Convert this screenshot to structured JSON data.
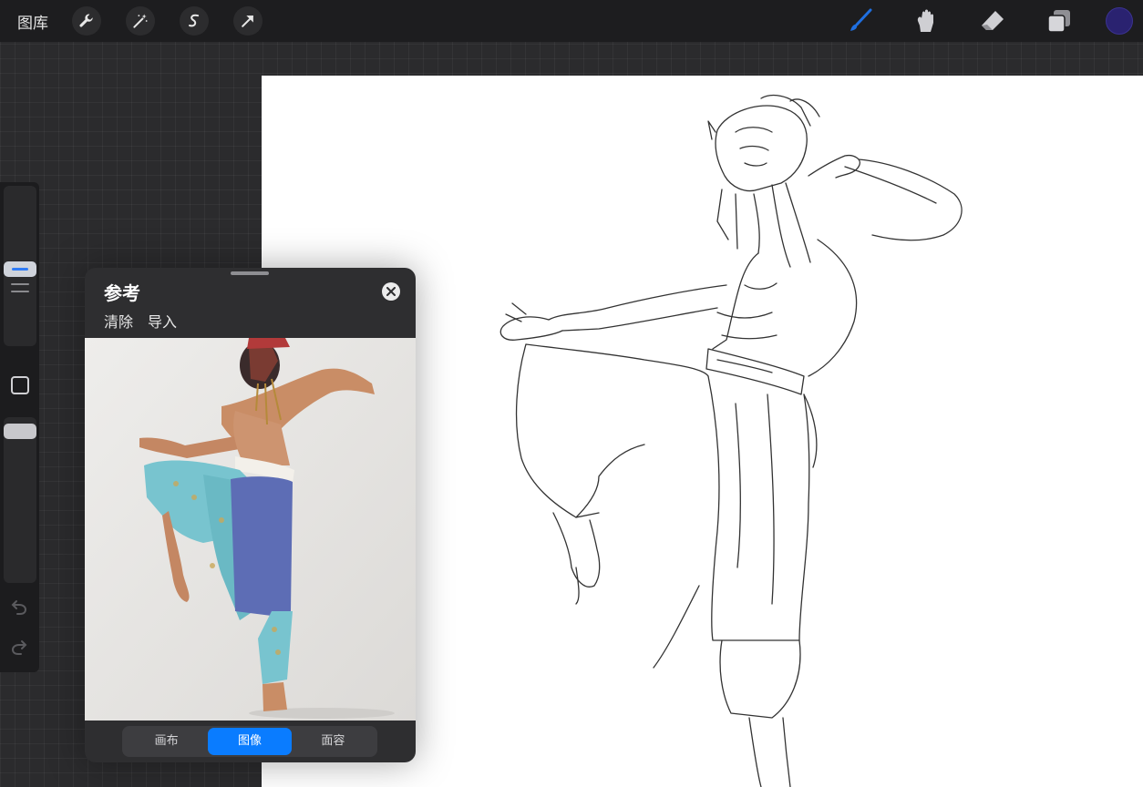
{
  "toolbar": {
    "gallery_label": "图库",
    "left_tools": [
      "wrench-icon",
      "magic-wand-icon",
      "selection-s-icon",
      "transform-arrow-icon"
    ],
    "right_tools": [
      "brush-icon",
      "smudge-icon",
      "eraser-icon",
      "layers-icon"
    ],
    "active_tool": "brush-icon",
    "current_color": "#2a2270",
    "accent": "#1f6fe0"
  },
  "sidebar": {
    "items": [
      "brush-size-slider",
      "modify-button",
      "opacity-slider",
      "undo-icon",
      "redo-icon"
    ]
  },
  "reference": {
    "title": "参考",
    "actions": [
      "清除",
      "导入"
    ],
    "tabs": [
      "画布",
      "图像",
      "面容"
    ],
    "active_tab": "图像"
  }
}
